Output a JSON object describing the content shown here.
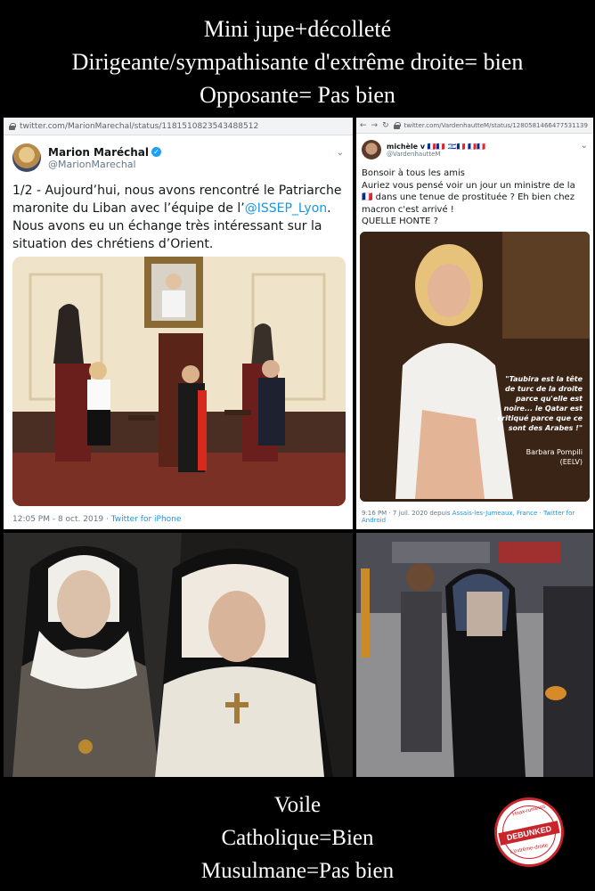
{
  "top_banner": {
    "line1": "Mini jupe+décolleté",
    "line2": "Dirigeante/sympathisante d'extrême droite= bien",
    "line3": "Opposante= Pas bien"
  },
  "left_tweet": {
    "url": "twitter.com/MarionMarechal/status/1181510823543488512",
    "name": "Marion Maréchal",
    "handle": "@MarionMarechal",
    "text_before": "1/2 - Aujourd’hui, nous avons rencontré le Patriarche maronite du Liban avec l’équipe de l’",
    "mention": "@ISSEP_Lyon",
    "text_after": ". Nous avons eu un échange très intéressant sur la situation des chrétiens d’Orient.",
    "timestamp": "12:05 PM - 8 oct. 2019 · ",
    "source": "Twitter for iPhone"
  },
  "right_tweet": {
    "url": "twitter.com/VardenhautteM/status/1280581466477531139",
    "name": "michèle v 🇫🇷🇫🇷 🇮🇱🇫🇷 🇫🇷🇫🇷",
    "handle": "@VardenhautteM",
    "text": "Bonsoir à tous les amis\nAuriez vous pensé  voir un jour un ministre de la 🇫🇷 dans une tenue de prostituée ? Eh bien chez macron c'est arrivé !\nQUELLE HONTE ?",
    "quote": "\"Taubira est la tête de turc de la droite parce qu'elle est noire... le Qatar est critiqué parce que ce sont des Arabes !\"",
    "quote_author": "Barbara Pompili",
    "quote_party": "(EELV)",
    "timestamp": "9:16 PM · 7 juil. 2020 depuis ",
    "place": "Assais-les-Jumeaux, France",
    "sep": " · ",
    "source": "Twitter for Android"
  },
  "bottom_banner": {
    "line1": "Voile",
    "line2": "Catholique=Bien",
    "line3": "Musulmane=Pas bien"
  },
  "stamp": {
    "top_text": "Hoax-rumeurs",
    "center_text": "DEBUNKED",
    "bottom_text": "L'extrême-droite"
  },
  "colors": {
    "background": "#000000",
    "twitter_blue": "#1b95e0",
    "stamp_red": "#c8242a"
  }
}
